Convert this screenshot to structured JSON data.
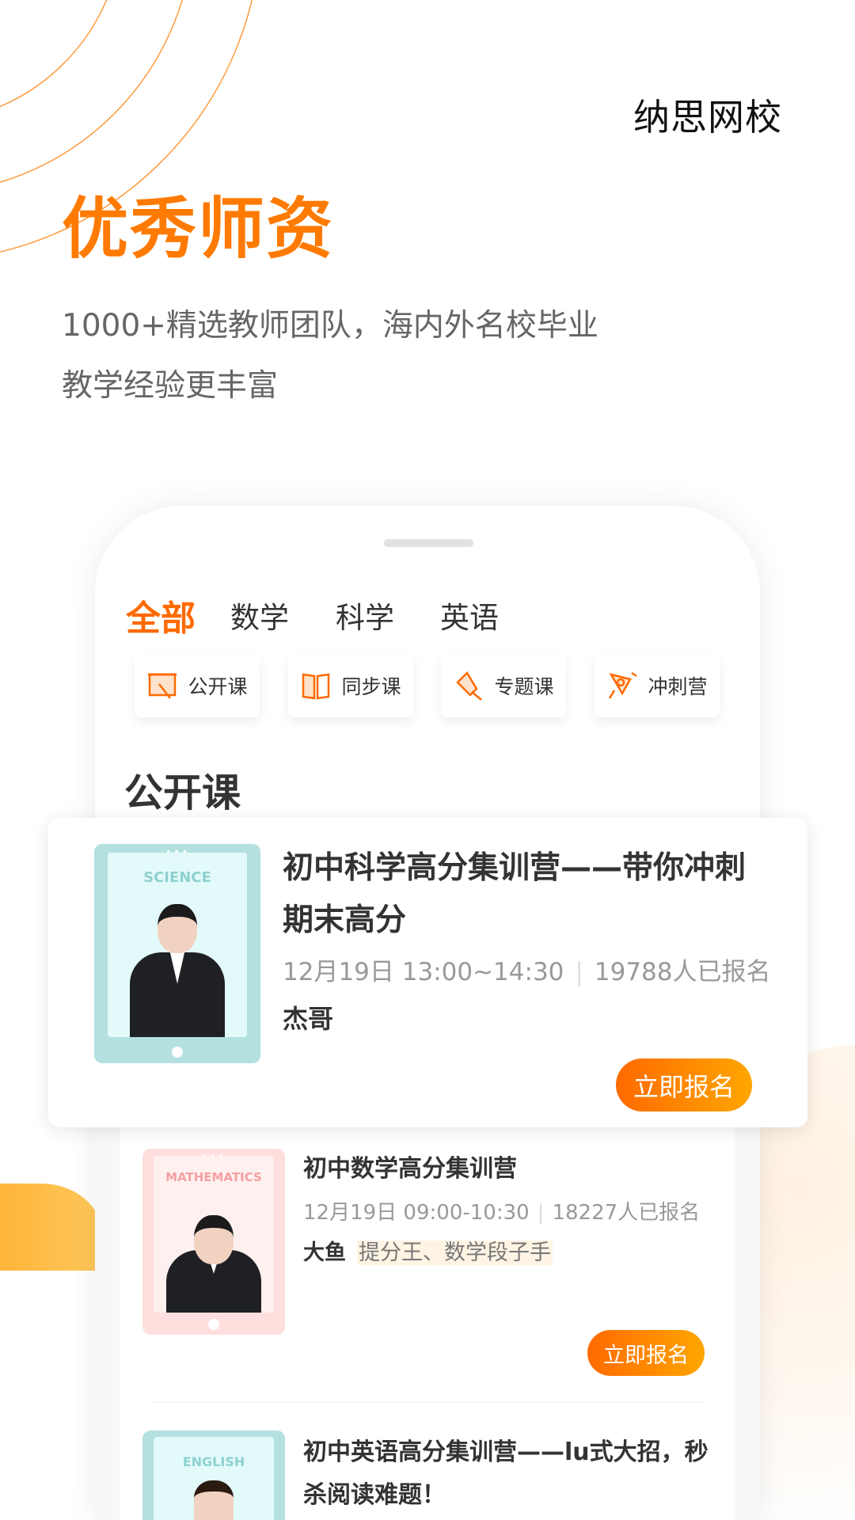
{
  "brand": {
    "logo": "纳思网校"
  },
  "hero": {
    "title": "优秀师资",
    "subtitle_line1": "1000+精选教师团队，海内外名校毕业",
    "subtitle_line2": "教学经验更丰富"
  },
  "colors": {
    "accent": "#ff7a00",
    "button_start": "#ff6a00",
    "button_end": "#ffa600"
  },
  "tabs": [
    {
      "label": "全部",
      "active": true
    },
    {
      "label": "数学"
    },
    {
      "label": "科学"
    },
    {
      "label": "英语"
    }
  ],
  "categories": [
    {
      "label": "公开课",
      "icon": "board-icon"
    },
    {
      "label": "同步课",
      "icon": "book-icon"
    },
    {
      "label": "专题课",
      "icon": "pin-icon"
    },
    {
      "label": "冲刺营",
      "icon": "rocket-icon"
    }
  ],
  "section_title": "公开课",
  "courses": [
    {
      "subject": "SCIENCE",
      "title": "初中科学高分集训营——带你冲刺期末高分",
      "date": "12月19日 13:00~14:30",
      "enrolled": "19788人已报名",
      "teacher": "杰哥",
      "tag": "",
      "button": "立即报名"
    },
    {
      "subject": "MATHEMATICS",
      "title": "初中数学高分集训营",
      "date": "12月19日 09:00-10:30",
      "enrolled": "18227人已报名",
      "teacher": "大鱼",
      "tag": "提分王、数学段子手",
      "button": "立即报名"
    },
    {
      "subject": "ENGLISH",
      "title": "初中英语高分集训营——lu式大招，秒杀阅读难题！"
    }
  ]
}
